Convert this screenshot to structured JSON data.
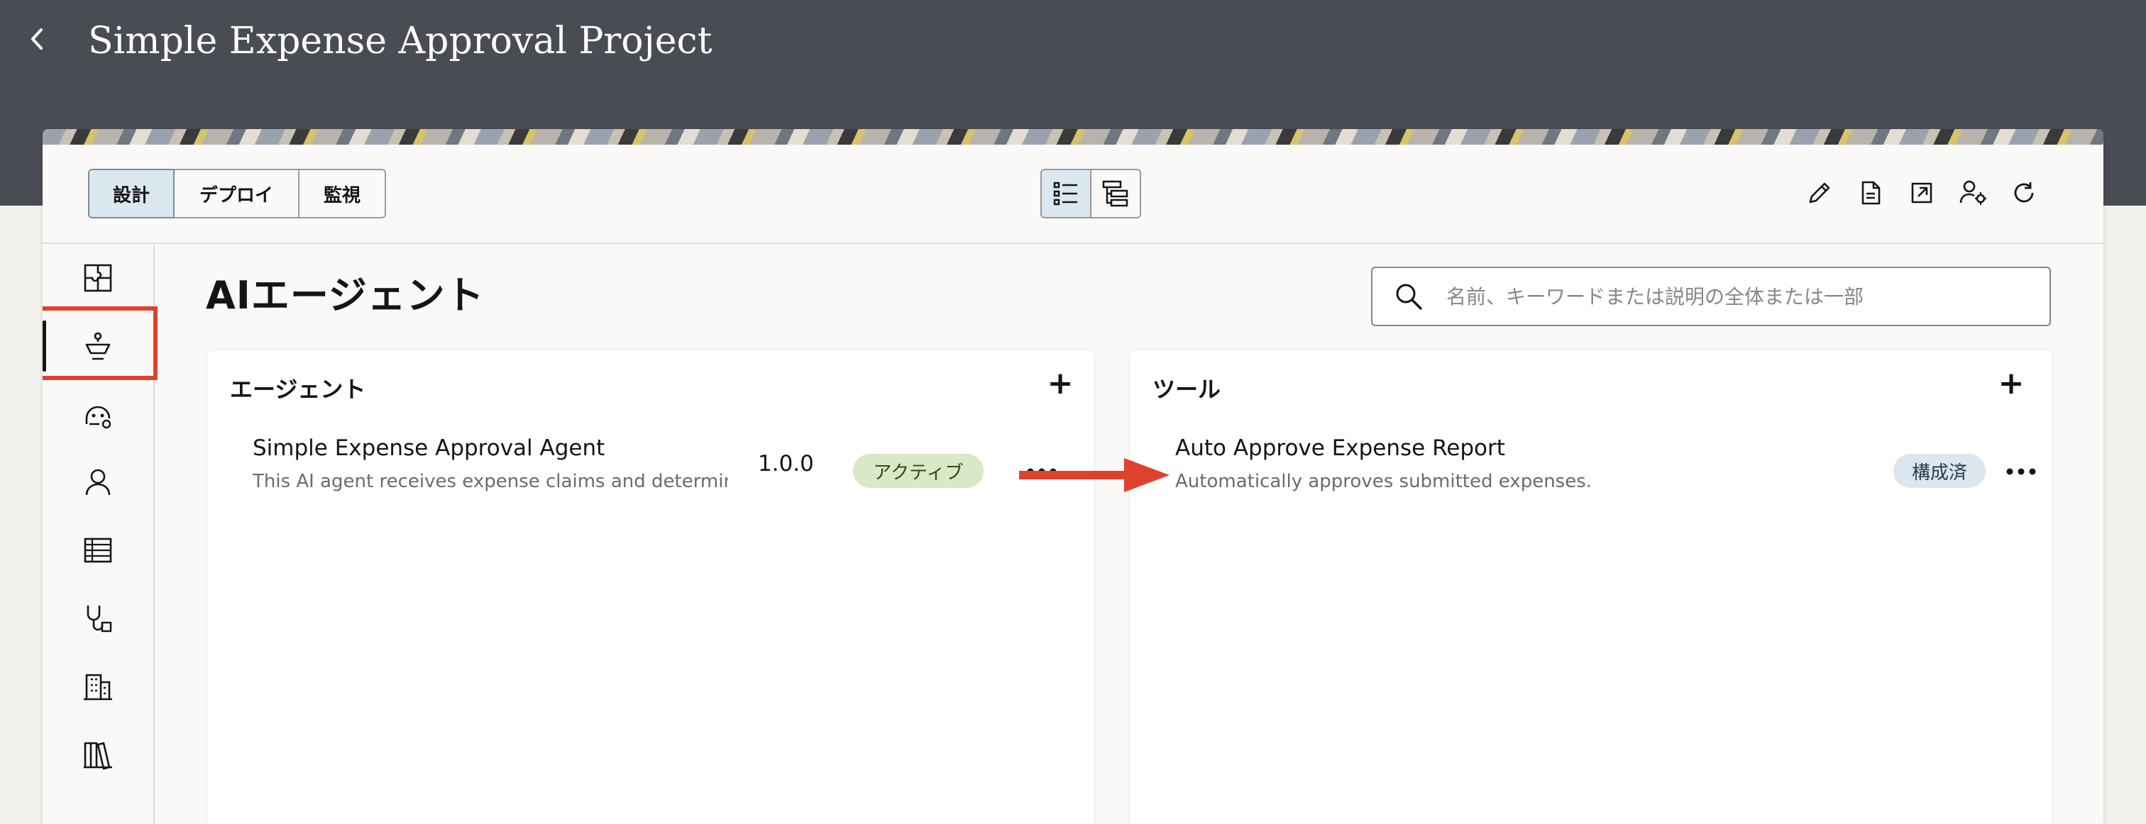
{
  "header": {
    "title": "Simple Expense Approval Project"
  },
  "toolbar": {
    "tabs": [
      {
        "label": "設計",
        "selected": true
      },
      {
        "label": "デプロイ",
        "selected": false
      },
      {
        "label": "監視",
        "selected": false
      }
    ],
    "view_modes": [
      "list-view-icon",
      "tree-view-icon"
    ],
    "actions": [
      "edit-icon",
      "document-icon",
      "open-external-icon",
      "user-settings-icon",
      "refresh-icon"
    ]
  },
  "sidebar": {
    "items": [
      {
        "icon": "puzzle-icon"
      },
      {
        "icon": "agent-icon",
        "active": true
      },
      {
        "icon": "robot-settings-icon"
      },
      {
        "icon": "user-icon"
      },
      {
        "icon": "table-icon"
      },
      {
        "icon": "stethoscope-icon"
      },
      {
        "icon": "building-icon"
      },
      {
        "icon": "library-icon"
      }
    ]
  },
  "main": {
    "title": "AIエージェント",
    "search": {
      "placeholder": "名前、キーワードまたは説明の全体または一部",
      "value": ""
    },
    "agents_card": {
      "title": "エージェント",
      "add_label": "+",
      "items": [
        {
          "name": "Simple Expense Approval Agent",
          "description": "This AI agent receives expense claims and determin…",
          "version": "1.0.0",
          "status": "アクティブ"
        }
      ]
    },
    "tools_card": {
      "title": "ツール",
      "add_label": "+",
      "items": [
        {
          "name": "Auto Approve Expense Report",
          "description": "Automatically approves submitted expenses.",
          "status": "構成済"
        }
      ]
    }
  },
  "colors": {
    "header_bg": "#494c53",
    "highlight": "#e0412c",
    "active_badge": "#d9e8c6",
    "config_badge": "#dbe6ee",
    "selected_tab": "#dce8f0"
  }
}
